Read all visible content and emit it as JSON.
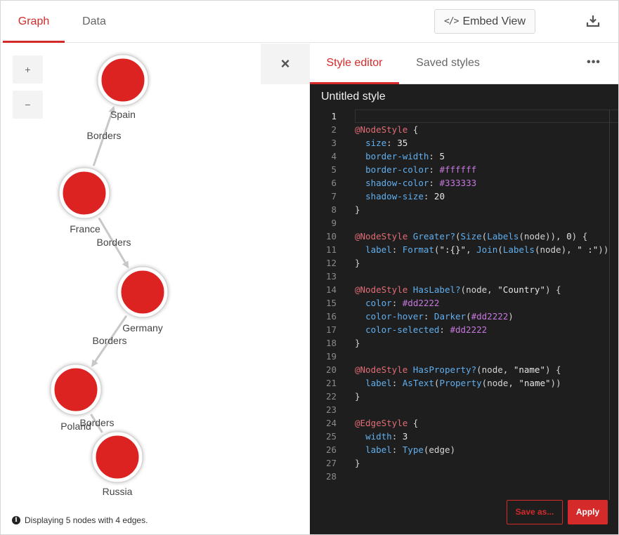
{
  "tabs": {
    "graph": "Graph",
    "data": "Data"
  },
  "toolbar": {
    "embed_code_glyph": "</>",
    "embed_label": "Embed View",
    "download_icon": "download-icon"
  },
  "zoom": {
    "in": "+",
    "out": "−"
  },
  "close_glyph": "×",
  "graph": {
    "nodes": [
      {
        "id": "spain",
        "label": "Spain"
      },
      {
        "id": "france",
        "label": "France"
      },
      {
        "id": "germany",
        "label": "Germany"
      },
      {
        "id": "poland",
        "label": "Poland"
      },
      {
        "id": "russia",
        "label": "Russia"
      }
    ],
    "edges": [
      {
        "from": "spain",
        "to": "france",
        "label": "Borders",
        "arrow": "start"
      },
      {
        "from": "france",
        "to": "germany",
        "label": "Borders",
        "arrow": "end"
      },
      {
        "from": "germany",
        "to": "poland",
        "label": "Borders",
        "arrow": "end"
      },
      {
        "from": "poland",
        "to": "russia",
        "label": "Borders",
        "arrow": "none"
      }
    ],
    "node_color": "#dd2222",
    "node_border_color": "#ffffff",
    "shadow_color": "#333333",
    "edge_color": "#c8c8c8"
  },
  "status": "Displaying 5 nodes with 4 edges.",
  "panel": {
    "tab_style_editor": "Style editor",
    "tab_saved_styles": "Saved styles",
    "more_glyph": "•••",
    "style_name": "Untitled style",
    "save_as": "Save as...",
    "apply": "Apply"
  },
  "code_lines": [
    "",
    "@NodeStyle {",
    "  size: 35",
    "  border-width: 5",
    "  border-color: #ffffff",
    "  shadow-color: #333333",
    "  shadow-size: 20",
    "}",
    "",
    "@NodeStyle Greater?(Size(Labels(node)), 0) {",
    "  label: Format(\":{}\", Join(Labels(node), \" :\"))",
    "}",
    "",
    "@NodeStyle HasLabel?(node, \"Country\") {",
    "  color: #dd2222",
    "  color-hover: Darker(#dd2222)",
    "  color-selected: #dd2222",
    "}",
    "",
    "@NodeStyle HasProperty?(node, \"name\") {",
    "  label: AsText(Property(node, \"name\"))",
    "}",
    "",
    "@EdgeStyle {",
    "  width: 3",
    "  label: Type(edge)",
    "}",
    ""
  ],
  "accent_color": "#d42a2a"
}
